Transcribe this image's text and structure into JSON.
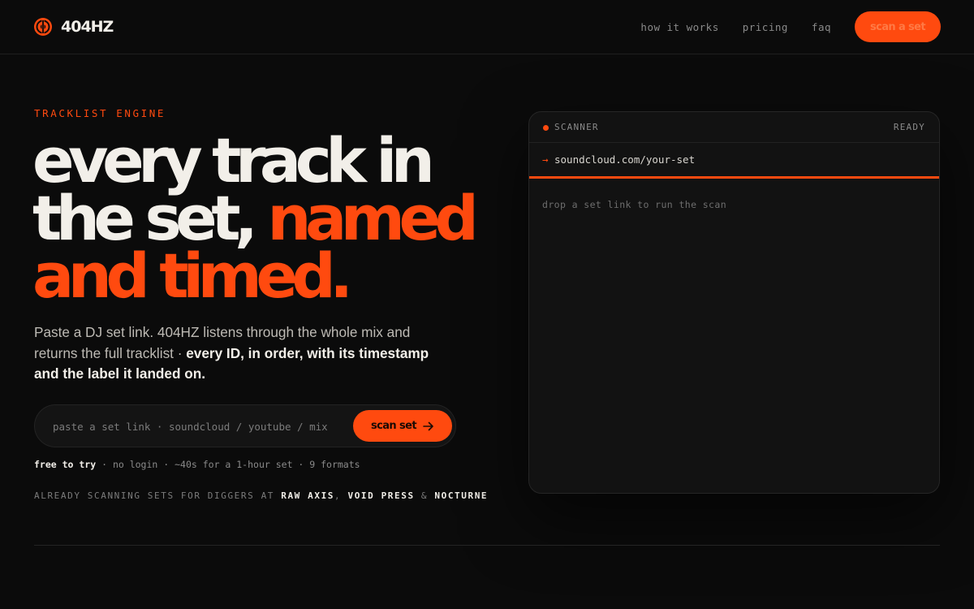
{
  "brand": {
    "name": "404HZ"
  },
  "nav": {
    "links": [
      "how it works",
      "pricing",
      "faq"
    ],
    "cta": "scan a set"
  },
  "hero": {
    "eyebrow": "TRACKLIST ENGINE",
    "headline": {
      "line1": "every track in",
      "line2_white": "the set, ",
      "line2_orange": "named",
      "line3": "and timed."
    },
    "description": {
      "plain": "Paste a DJ set link. 404HZ listens through the whole mix and returns the full tracklist · ",
      "bold": "every ID, in order, with its timestamp and the label it landed on."
    },
    "form": {
      "placeholder": "paste a set link · soundcloud / youtube / mix",
      "button": "scan set"
    },
    "meta": {
      "bold": "free to try",
      "rest": " · no login · ~40s for a 1-hour set · 9 formats"
    },
    "trust": {
      "prefix": "ALREADY SCANNING SETS FOR DIGGERS AT ",
      "label1": "RAW AXIS",
      "sep1": ", ",
      "label2": "VOID PRESS",
      "sep2": " & ",
      "label3": "NOCTURNE"
    }
  },
  "scanner": {
    "title": "SCANNER",
    "status": "READY",
    "url_arrow": "→",
    "url": "soundcloud.com/your-set",
    "empty_message": "drop a set link to run the scan"
  },
  "colors": {
    "accent": "#ff4a0f",
    "background": "#0b0b0b",
    "text": "#f2efe9"
  }
}
